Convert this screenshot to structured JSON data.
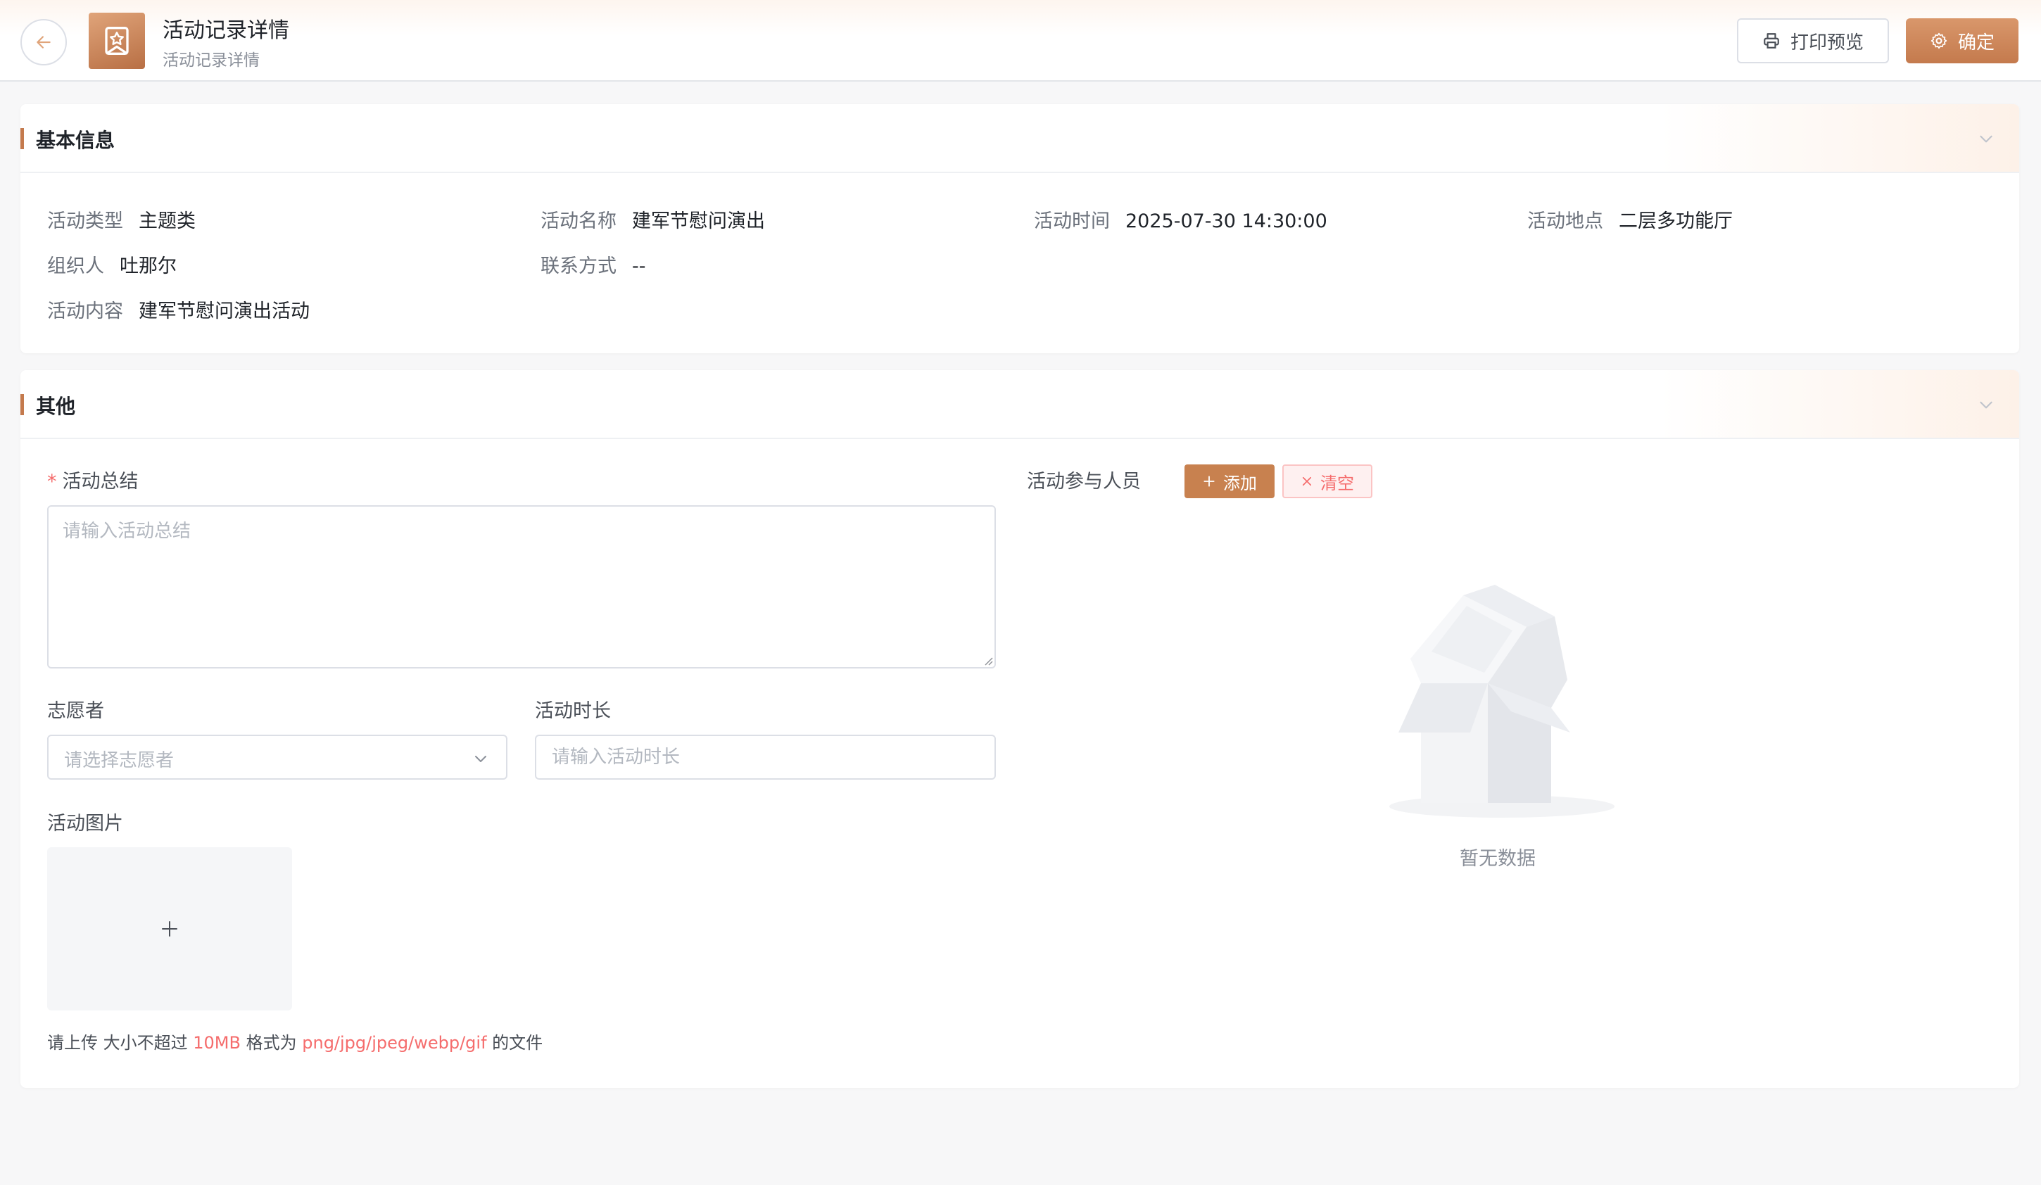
{
  "header": {
    "title": "活动记录详情",
    "subtitle": "活动记录详情",
    "print_label": "打印预览",
    "confirm_label": "确定"
  },
  "basic_info": {
    "title": "基本信息",
    "fields": [
      {
        "label": "活动类型",
        "value": "主题类"
      },
      {
        "label": "活动名称",
        "value": "建军节慰问演出"
      },
      {
        "label": "活动时间",
        "value": "2025-07-30 14:30:00"
      },
      {
        "label": "活动地点",
        "value": "二层多功能厅"
      },
      {
        "label": "组织人",
        "value": "吐那尔"
      },
      {
        "label": "联系方式",
        "value": "--"
      },
      {
        "label": "活动内容",
        "value": "建军节慰问演出活动"
      }
    ]
  },
  "other": {
    "title": "其他",
    "summary": {
      "label": "活动总结",
      "required_mark": "*",
      "placeholder": "请输入活动总结",
      "value": ""
    },
    "volunteer": {
      "label": "志愿者",
      "placeholder": "请选择志愿者"
    },
    "duration": {
      "label": "活动时长",
      "placeholder": "请输入活动时长",
      "value": ""
    },
    "images": {
      "label": "活动图片",
      "tip_prefix": "请上传 大小不超过 ",
      "tip_size": "10MB",
      "tip_mid": " 格式为 ",
      "tip_formats": "png/jpg/jpeg/webp/gif",
      "tip_suffix": " 的文件"
    },
    "participants": {
      "label": "活动参与人员",
      "add_label": "添加",
      "clear_label": "清空",
      "empty_text": "暂无数据"
    }
  },
  "colors": {
    "accent": "#c47a4d",
    "danger": "#f56c6c"
  }
}
